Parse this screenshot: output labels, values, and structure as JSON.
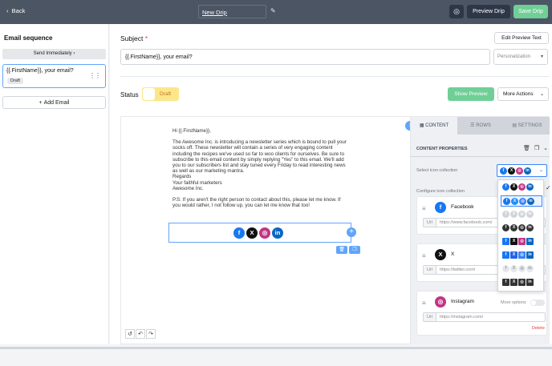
{
  "header": {
    "back_label": "Back",
    "title": "New Drip",
    "icon_button": "settings-target-icon",
    "preview_drip_label": "Preview Drip",
    "save_drip_label": "Save Drip"
  },
  "sidebar": {
    "heading": "Email sequence",
    "send_label": "Send Immediately",
    "items": [
      {
        "subject": "{{.FirstName}}, your email?",
        "badge": "Draft"
      }
    ],
    "add_email_label": "Add Email"
  },
  "editor": {
    "subject_label": "Subject",
    "required_mark": "*",
    "edit_preview_label": "Edit Preview Text",
    "subject_value": "{{.FirstName}}, your email?",
    "personalization_placeholder": "Personalization",
    "status_label": "Status",
    "status_value": "Draft",
    "show_preview_label": "Show Preview",
    "more_actions_label": "More Actions"
  },
  "email": {
    "greeting": "Hi {{.FirstName}},",
    "paragraph": "The Awesome Inc. is introducing a newsletter series which is bound to pull your socks off. These newsletter will contain a series of very engaging content including the recipes we've used so far to woo clients for ourselves. Be sure to subscribe to this email content by simply replying \"Yes\" to this email. We'll add you to our subscribers list and stay tuned every Friday to read interesting news as well as our marketing mantra.",
    "regards": "Regards",
    "signoff": "Your faithful marketers",
    "company": "Awesome Inc.",
    "ps": "P.S: If you aren't the right person to contact about this, please let me know. If you would rather, I not follow up, you can let me know that too!"
  },
  "panel": {
    "tabs": [
      {
        "label": "CONTENT",
        "active": true
      },
      {
        "label": "ROWS",
        "active": false
      },
      {
        "label": "SETTINGS",
        "active": false
      }
    ],
    "content_properties_label": "CONTENT PROPERTIES",
    "select_icon_label": "Select icon collection",
    "configure_icon_label": "Configure icon collection",
    "url_tag": "Url",
    "more_options_label": "More options",
    "delete_label": "Delete",
    "socials": [
      {
        "name": "Facebook",
        "url": "https://www.facebook.com/",
        "icon": "facebook-icon"
      },
      {
        "name": "X",
        "url": "https://twitter.com/",
        "icon": "x-icon"
      },
      {
        "name": "Instagram",
        "url": "https://instagram.com/",
        "icon": "instagram-icon"
      }
    ],
    "collection_styles": [
      "colored-circle",
      "colored-circle-selected",
      "grey-outline",
      "dark-circle",
      "colored-square",
      "colored-square-outline",
      "light-grey",
      "dark-square"
    ]
  },
  "colors": {
    "accent_green": "#6fcf97",
    "accent_blue": "#60a5fa",
    "draft_yellow": "#fde68a",
    "facebook": "#1877f2",
    "x": "#111111",
    "instagram": "#c13584",
    "linkedin": "#0a66c2"
  }
}
